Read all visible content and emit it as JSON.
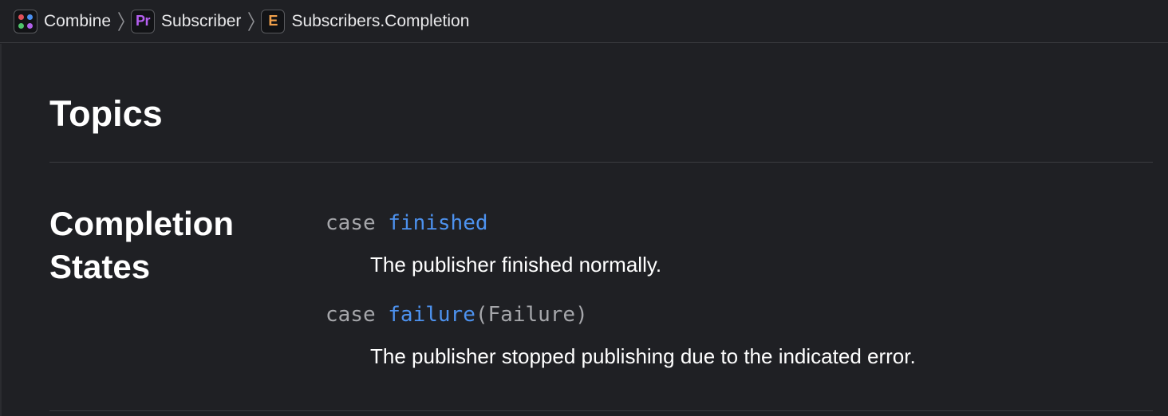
{
  "breadcrumb": {
    "items": [
      {
        "icon": "combine-framework-icon",
        "label": "Combine"
      },
      {
        "icon": "protocol-icon",
        "icon_text": "Pr",
        "label": "Subscriber"
      },
      {
        "icon": "enum-icon",
        "icon_text": "E",
        "label": "Subscribers.Completion"
      }
    ]
  },
  "topics": {
    "title": "Topics",
    "sections": [
      {
        "title": "Completion States",
        "items": [
          {
            "keyword": "case",
            "name": "finished",
            "suffix": "",
            "description": "The publisher finished normally."
          },
          {
            "keyword": "case",
            "name": "failure",
            "suffix": "(Failure)",
            "description": "The publisher stopped publishing due to the indicated error."
          }
        ]
      }
    ]
  },
  "colors": {
    "background": "#1f2024",
    "link": "#4d92ef",
    "keyword": "#a6a7ab",
    "protocol_icon": "#b55ff0",
    "enum_icon": "#f0a04b",
    "framework_dots": [
      "#e0505a",
      "#4b8ff0",
      "#4fc36b",
      "#b060e8"
    ]
  }
}
